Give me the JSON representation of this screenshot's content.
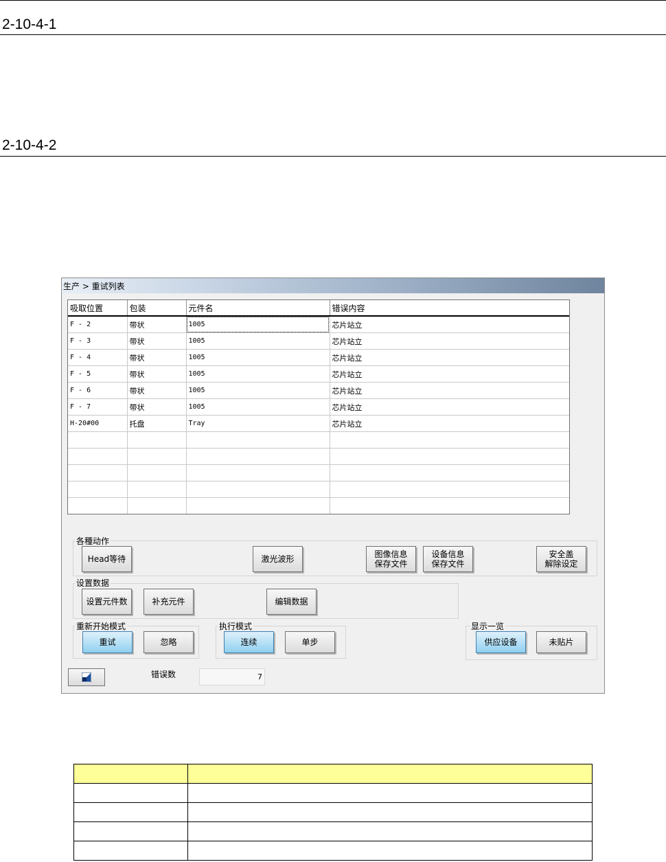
{
  "page": {
    "section1": "2-10-4-1",
    "section2": "2-10-4-2"
  },
  "window": {
    "title": "生产 > 重试列表",
    "columns": [
      "吸取位置",
      "包装",
      "元件名",
      "错误内容"
    ],
    "rows": [
      [
        "F -  2",
        "带状",
        "1005",
        "芯片站立"
      ],
      [
        "F -  3",
        "带状",
        "1005",
        "芯片站立"
      ],
      [
        "F -  4",
        "带状",
        "1005",
        "芯片站立"
      ],
      [
        "F -  5",
        "带状",
        "1005",
        "芯片站立"
      ],
      [
        "F -  6",
        "带状",
        "1005",
        "芯片站立"
      ],
      [
        "F -  7",
        "带状",
        "1005",
        "芯片站立"
      ],
      [
        "H-20#00",
        "托盘",
        "Tray",
        "芯片站立"
      ],
      [
        "",
        "",
        "",
        ""
      ],
      [
        "",
        "",
        "",
        ""
      ],
      [
        "",
        "",
        "",
        ""
      ],
      [
        "",
        "",
        "",
        ""
      ],
      [
        "",
        "",
        "",
        ""
      ]
    ],
    "actions": {
      "label": "各種动作",
      "head_wait": "Head等待",
      "laser_wave": "激光波形",
      "image_save": "图像信息\n保存文件",
      "device_save": "设备信息\n保存文件",
      "safety_release": "安全盖\n解除设定"
    },
    "settings": {
      "label": "设置数据",
      "set_count": "设置元件数",
      "add_part": "补充元件",
      "edit_data": "编辑数据"
    },
    "restart": {
      "label": "重新开始模式",
      "retry": "重试",
      "ignore": "忽略"
    },
    "exec": {
      "label": "执行模式",
      "continuous": "连续",
      "step": "单步"
    },
    "display": {
      "label": "显示一览",
      "feeder": "供应设备",
      "unplaced": "未贴片"
    },
    "error_count_label": "错误数",
    "error_count": "7"
  },
  "colors": {
    "header_yellow": "#ffff99",
    "active_button": "#8fd0f0"
  }
}
